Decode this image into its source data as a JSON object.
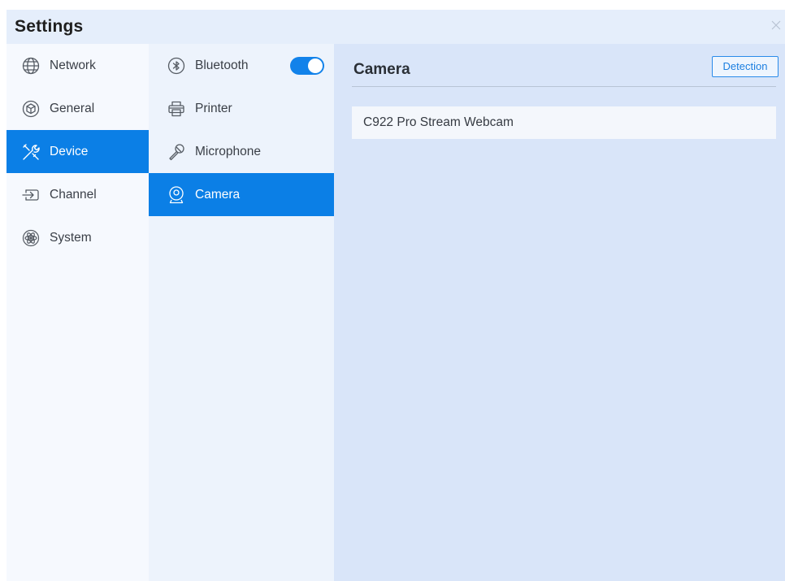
{
  "window": {
    "title": "Settings"
  },
  "categories": [
    {
      "label": "Network",
      "icon": "globe-icon",
      "active": false
    },
    {
      "label": "General",
      "icon": "cube-icon",
      "active": false
    },
    {
      "label": "Device",
      "icon": "tools-icon",
      "active": true
    },
    {
      "label": "Channel",
      "icon": "input-icon",
      "active": false
    },
    {
      "label": "System",
      "icon": "atom-icon",
      "active": false
    }
  ],
  "devices": [
    {
      "label": "Bluetooth",
      "icon": "bluetooth-icon",
      "active": false,
      "toggle_on": true
    },
    {
      "label": "Printer",
      "icon": "printer-icon",
      "active": false
    },
    {
      "label": "Microphone",
      "icon": "microphone-icon",
      "active": false
    },
    {
      "label": "Camera",
      "icon": "camera-icon",
      "active": true
    }
  ],
  "panel": {
    "title": "Camera",
    "detect_label": "Detection",
    "items": [
      "C922 Pro Stream Webcam"
    ]
  },
  "colors": {
    "accent": "#0b7fe6",
    "main_bg": "#d9e5f9",
    "sidebar_bg": "#f6f9fe",
    "subnav_bg": "#edf3fc"
  }
}
